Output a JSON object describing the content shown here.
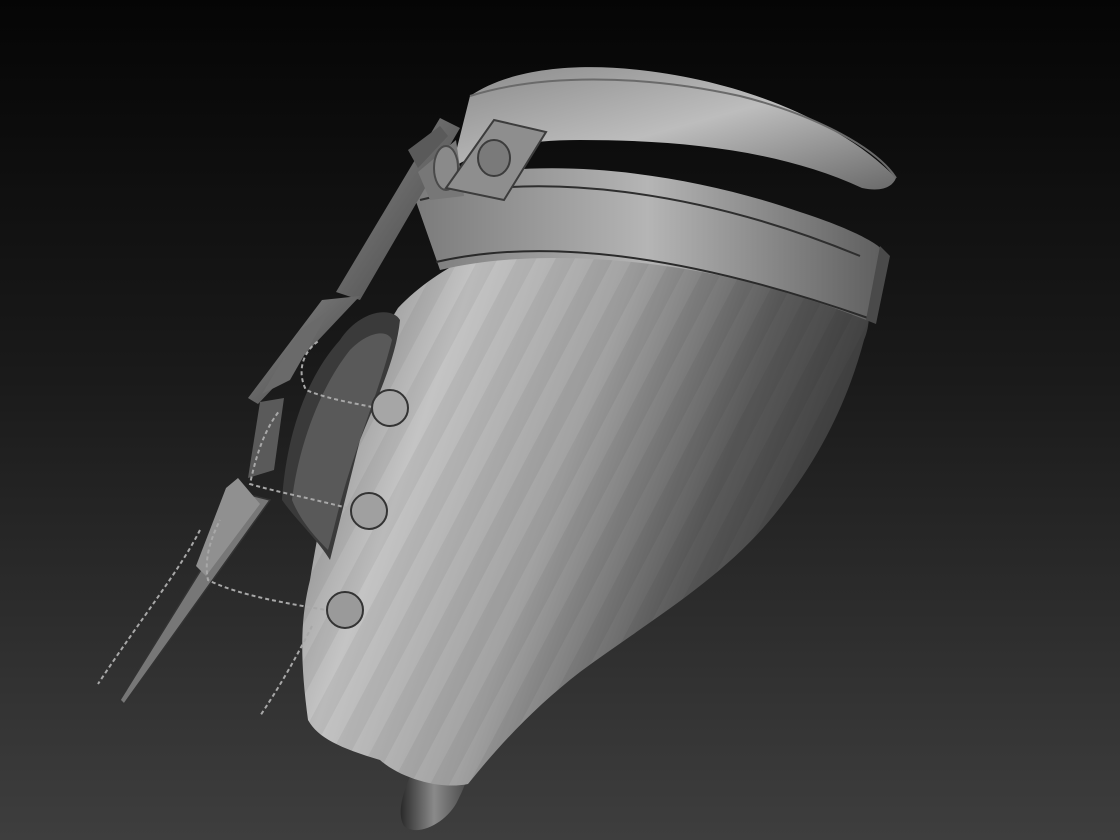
{
  "viewport": {
    "background_top": "#050505",
    "background_bottom": "#3e3e3e",
    "material_color": "#9a9a9a"
  },
  "model": {
    "kind": "sculpted-leg-armor-mesh",
    "belt_buckles": 2,
    "chain_buttons": 3,
    "chain_strands": 5
  }
}
